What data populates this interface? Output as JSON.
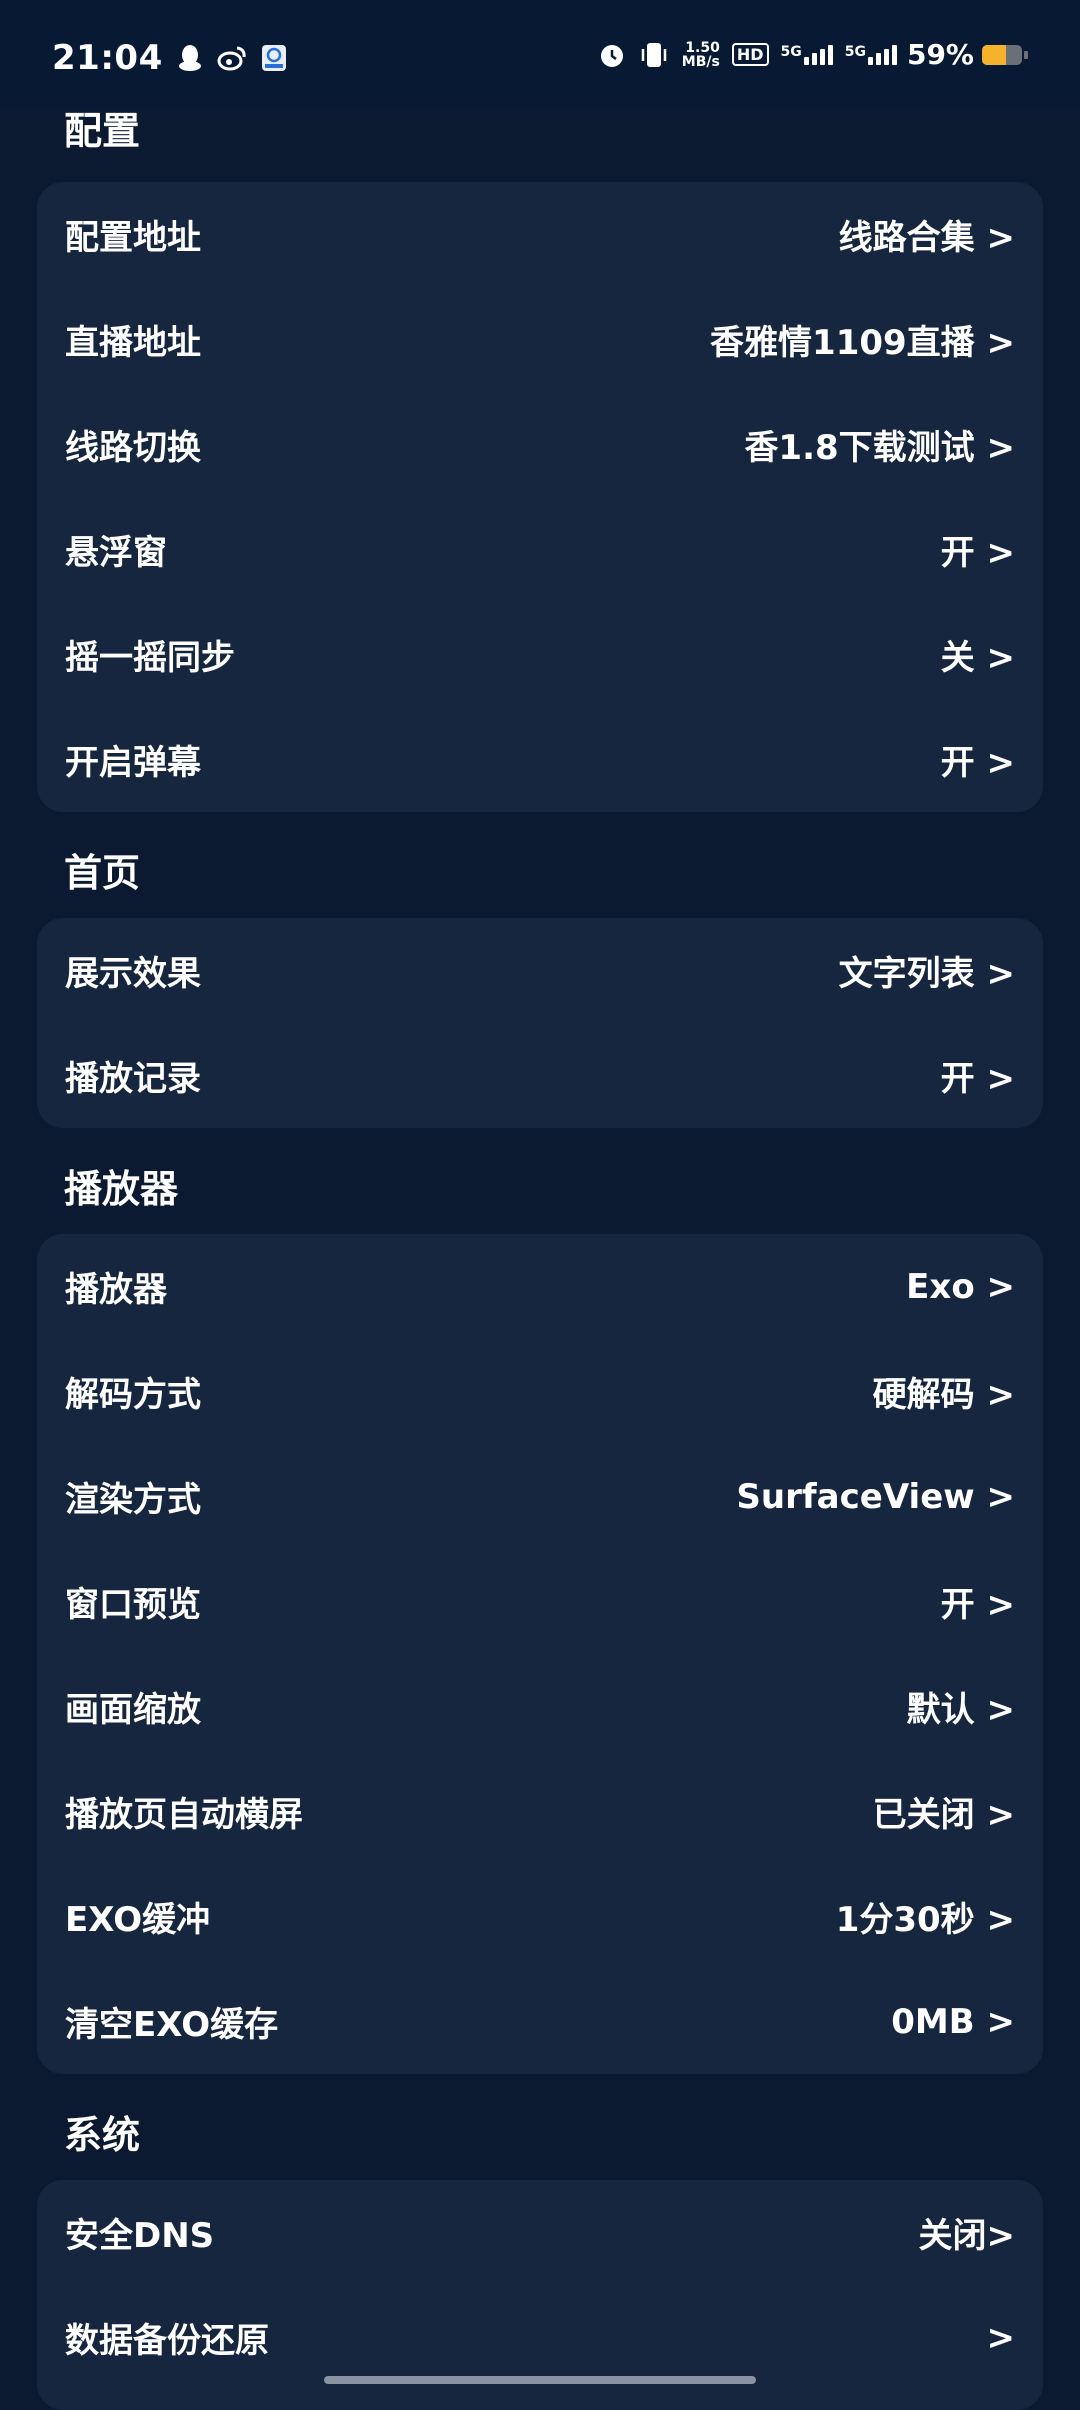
{
  "status_bar": {
    "time": "21:04",
    "speed_top": "1.50",
    "speed_bottom": "MB/s",
    "hd": "HD",
    "net1_label": "5G",
    "net2_label": "5G",
    "battery_percent": "59%",
    "battery_level": 0.59,
    "icons": [
      "qq-icon",
      "weibo-icon",
      "app-icon",
      "alarm-icon",
      "vibrate-icon",
      "signal-icon",
      "battery-icon"
    ],
    "battery_color": "#f4b32a"
  },
  "sections": {
    "config": {
      "title": "配置",
      "rows": [
        {
          "label": "配置地址",
          "value": "线路合集 >"
        },
        {
          "label": "直播地址",
          "value": "香雅情1109直播 >"
        },
        {
          "label": "线路切换",
          "value": "香1.8下载测试 >"
        },
        {
          "label": "悬浮窗",
          "value": "开 >"
        },
        {
          "label": "摇一摇同步",
          "value": "关 >"
        },
        {
          "label": "开启弹幕",
          "value": "开 >"
        }
      ]
    },
    "home": {
      "title": "首页",
      "rows": [
        {
          "label": "展示效果",
          "value": "文字列表 >"
        },
        {
          "label": "播放记录",
          "value": "开 >"
        }
      ]
    },
    "player": {
      "title": "播放器",
      "rows": [
        {
          "label": "播放器",
          "value": "Exo >"
        },
        {
          "label": "解码方式",
          "value": "硬解码 >"
        },
        {
          "label": "渲染方式",
          "value": "SurfaceView >"
        },
        {
          "label": "窗口预览",
          "value": "开 >"
        },
        {
          "label": "画面缩放",
          "value": "默认 >"
        },
        {
          "label": "播放页自动横屏",
          "value": "已关闭 >"
        },
        {
          "label": "EXO缓冲",
          "value": "1分30秒 >"
        },
        {
          "label": "清空EXO缓存",
          "value": "0MB >"
        }
      ]
    },
    "system": {
      "title": "系统",
      "rows": [
        {
          "label": "安全DNS",
          "value": "关闭>"
        },
        {
          "label": "数据备份还原",
          "value": ">"
        }
      ]
    }
  },
  "colors": {
    "background": "#0b1a30",
    "card": "#17263f",
    "text": "#ffffff"
  }
}
